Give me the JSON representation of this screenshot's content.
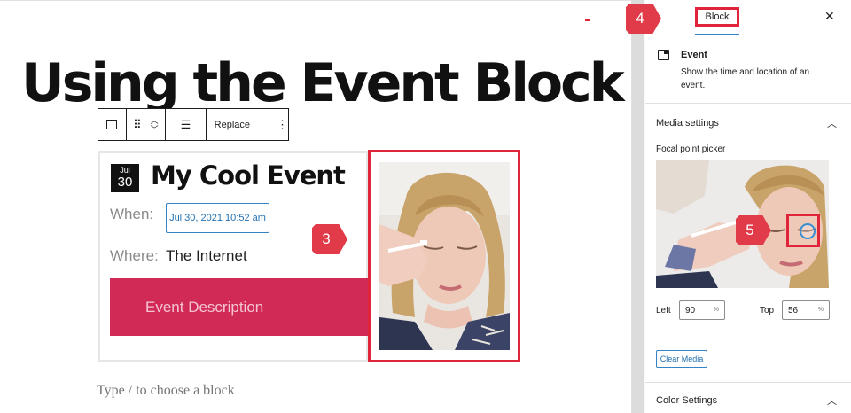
{
  "editor": {
    "post_title": "Using the Event Block",
    "placeholder": "Type / to choose a block",
    "toolbar": {
      "replace_label": "Replace",
      "more_glyph": "⋮",
      "drag_glyph": "⠿",
      "up_glyph": "︿",
      "down_glyph": "﹀",
      "align_glyph": "☰"
    }
  },
  "event_block": {
    "calendar_month": "Jul",
    "calendar_day": "30",
    "title": "My Cool Event",
    "when_label": "When:",
    "when_value": "Jul 30, 2021 10:52 am",
    "where_label": "Where:",
    "where_value": "The Internet",
    "description_button": "Event Description"
  },
  "callouts": {
    "image": "3",
    "block_tab": "4",
    "focal": "5"
  },
  "sidebar": {
    "tab_label": "Block",
    "close_glyph": "✕",
    "block_card": {
      "name": "Event",
      "description": "Show the time and location of an event."
    },
    "media_settings": {
      "title": "Media settings",
      "chevron": "︿",
      "focal_label": "Focal point picker",
      "left_label": "Left",
      "left_value": "90",
      "top_label": "Top",
      "top_value": "56",
      "percent": "%",
      "clear_button": "Clear Media"
    },
    "color_settings": {
      "title": "Color Settings",
      "chevron": "︿"
    }
  },
  "colors": {
    "accent_blue": "#3582c4",
    "callout_red": "#e0243a",
    "description_bg": "#d22a57"
  }
}
